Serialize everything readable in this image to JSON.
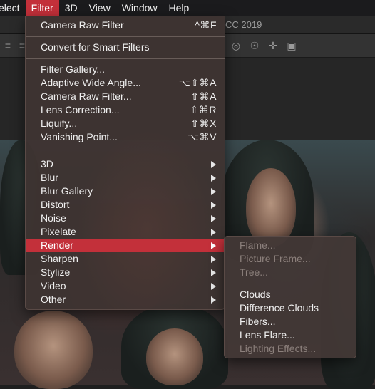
{
  "menubar": {
    "items": [
      {
        "label": "elect",
        "active": false
      },
      {
        "label": "Filter",
        "active": true
      },
      {
        "label": "3D",
        "active": false
      },
      {
        "label": "View",
        "active": false
      },
      {
        "label": "Window",
        "active": false
      },
      {
        "label": "Help",
        "active": false
      }
    ]
  },
  "app": {
    "title_fragment": "CC 2019"
  },
  "filter_menu": {
    "top_items": [
      {
        "label": "Camera Raw Filter",
        "shortcut": "^⌘F"
      },
      {
        "label": "Convert for Smart Filters",
        "shortcut": ""
      }
    ],
    "filters": [
      {
        "label": "Filter Gallery...",
        "shortcut": ""
      },
      {
        "label": "Adaptive Wide Angle...",
        "shortcut": "⌥⇧⌘A"
      },
      {
        "label": "Camera Raw Filter...",
        "shortcut": "⇧⌘A"
      },
      {
        "label": "Lens Correction...",
        "shortcut": "⇧⌘R"
      },
      {
        "label": "Liquify...",
        "shortcut": "⇧⌘X"
      },
      {
        "label": "Vanishing Point...",
        "shortcut": "⌥⌘V"
      }
    ],
    "submenus": [
      {
        "label": "3D"
      },
      {
        "label": "Blur"
      },
      {
        "label": "Blur Gallery"
      },
      {
        "label": "Distort"
      },
      {
        "label": "Noise"
      },
      {
        "label": "Pixelate"
      },
      {
        "label": "Render",
        "selected": true
      },
      {
        "label": "Sharpen"
      },
      {
        "label": "Stylize"
      },
      {
        "label": "Video"
      },
      {
        "label": "Other"
      }
    ]
  },
  "render_submenu": {
    "disabled_items": [
      "Flame...",
      "Picture Frame...",
      "Tree..."
    ],
    "items": [
      {
        "label": "Clouds",
        "enabled": true
      },
      {
        "label": "Difference Clouds",
        "enabled": true
      },
      {
        "label": "Fibers...",
        "enabled": true
      },
      {
        "label": "Lens Flare...",
        "enabled": true
      },
      {
        "label": "Lighting Effects...",
        "enabled": false
      }
    ]
  },
  "colors": {
    "accent": "#c3303a",
    "menu_bg": "#3e3432",
    "menubar_bg": "#1b1b1d"
  },
  "icons": [
    "align-icon",
    "distribute-icon",
    "rotate-3d-icon",
    "roll-3d-icon",
    "drag-3d-icon",
    "slide-3d-icon",
    "video-camera-icon"
  ]
}
